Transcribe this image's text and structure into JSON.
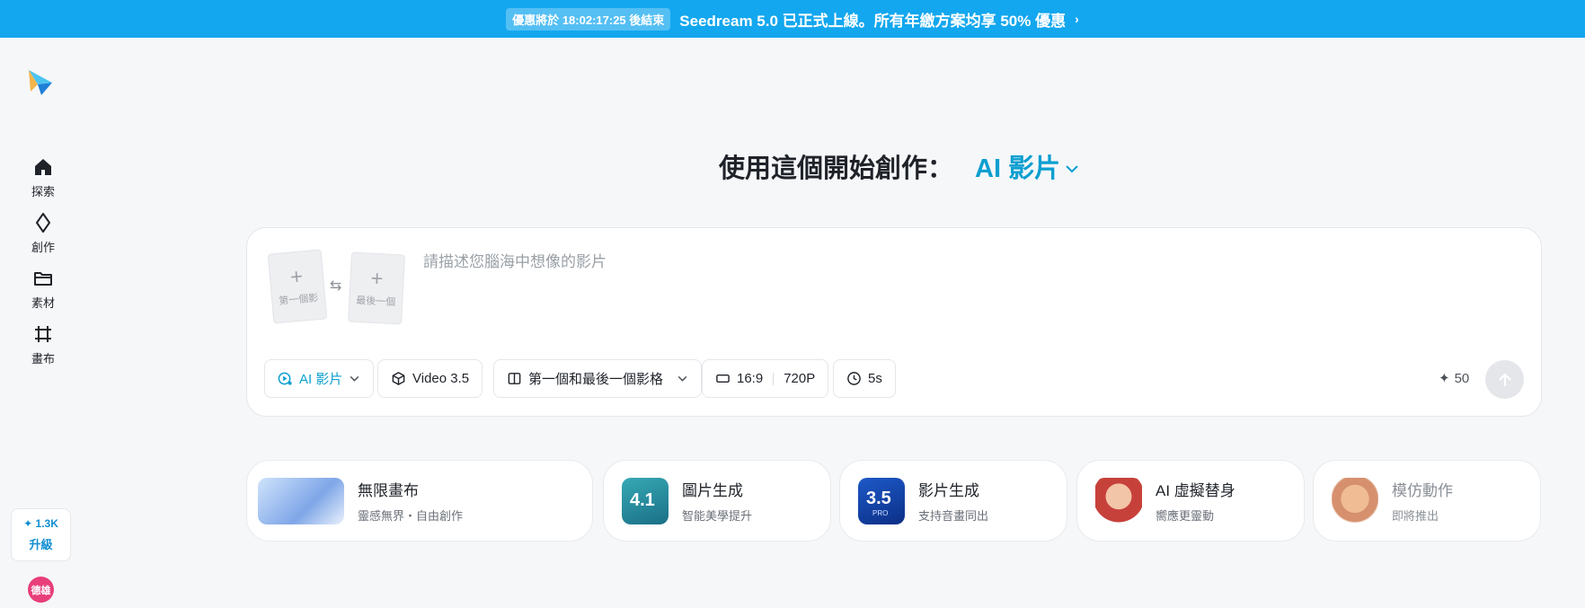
{
  "banner": {
    "countdown": "優惠將於 18:02:17:25 後結束",
    "message": "Seedream 5.0 已正式上線。所有年繳方案均享 50% 優惠",
    "chevron": "›"
  },
  "sidebar": {
    "logo_icon": "paper-plane-logo-icon",
    "items": [
      {
        "label": "探索",
        "icon": "home-icon"
      },
      {
        "label": "創作",
        "icon": "sparkle-icon"
      },
      {
        "label": "素材",
        "icon": "folder-icon"
      },
      {
        "label": "畫布",
        "icon": "canvas-icon"
      }
    ],
    "upgrade": {
      "credits": "✦ 1.3K",
      "label": "升級"
    },
    "avatar_text": "德雄",
    "avatar_color": "#e83f7b"
  },
  "heading": {
    "prefix": "使用這個開始創作：",
    "mode": "AI 影片"
  },
  "prompt": {
    "first_frame": "第一個影",
    "last_frame": "最後一個",
    "placeholder": "請描述您腦海中想像的影片",
    "value": "",
    "chips": {
      "mode": "AI 影片",
      "model": "Video 3.5",
      "reference": "第一個和最後一個影格",
      "ratio": "16:9",
      "resolution": "720P",
      "duration": "5s"
    },
    "cost": "50",
    "accent": "#0b9fd0"
  },
  "features": [
    {
      "title": "無限畫布",
      "subtitle": "靈感無界・自由創作",
      "icon": "pegasus-thumbnail"
    },
    {
      "title": "圖片生成",
      "subtitle": "智能美學提升",
      "icon": "image-4-1-icon"
    },
    {
      "title": "影片生成",
      "subtitle": "支持音畫同出",
      "icon": "video-3-5-pro-icon"
    },
    {
      "title": "AI 虛擬替身",
      "subtitle": "嚮應更靈動",
      "icon": "avatar-thumbnail"
    },
    {
      "title": "模仿動作",
      "subtitle": "即將推出",
      "icon": "motion-thumbnail"
    }
  ],
  "colors": {
    "banner": "#13a7ef",
    "background": "#f6f7f9"
  }
}
